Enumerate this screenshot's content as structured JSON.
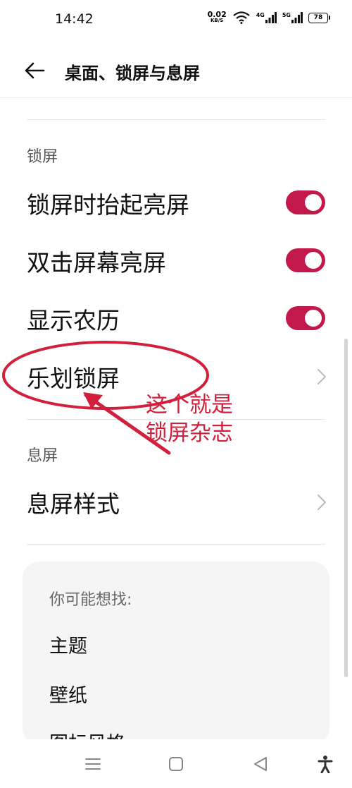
{
  "status_bar": {
    "time": "14:42",
    "net_speed_value": "0.02",
    "net_speed_unit": "KB/S",
    "signal1": "4G",
    "signal2": "5G",
    "battery": "78"
  },
  "header": {
    "title": "桌面、锁屏与息屏"
  },
  "sections": {
    "lock_screen": {
      "label": "锁屏",
      "items": [
        {
          "label": "锁屏时抬起亮屏",
          "toggle_on": true
        },
        {
          "label": "双击屏幕亮屏",
          "toggle_on": true
        },
        {
          "label": "显示农历",
          "toggle_on": true
        },
        {
          "label": "乐划锁屏"
        }
      ]
    },
    "screen_off": {
      "label": "息屏",
      "items": [
        {
          "label": "息屏样式"
        }
      ]
    }
  },
  "annotation": {
    "line1": "这个就是",
    "line2": "锁屏杂志",
    "color": "#d21f3c"
  },
  "suggestions": {
    "heading": "你可能想找:",
    "items": [
      "主题",
      "壁纸",
      "图标风格"
    ]
  },
  "colors": {
    "toggle_on": "#c2184b"
  }
}
